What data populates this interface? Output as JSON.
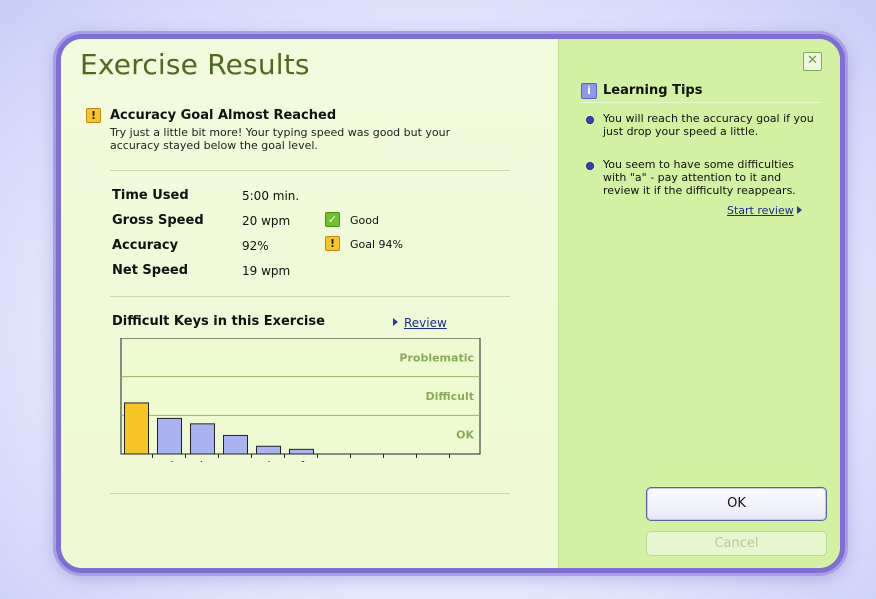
{
  "title": "Exercise Results",
  "goal": {
    "heading": "Accuracy Goal Almost Reached",
    "text": "Try just a little bit more! Your typing speed was good but your accuracy stayed below the goal level."
  },
  "stats": [
    {
      "label": "Time Used",
      "value": "5:00 min.",
      "note": "",
      "note_icon": ""
    },
    {
      "label": "Gross Speed",
      "value": "20 wpm",
      "note": "Good",
      "note_icon": "checkmark-icon"
    },
    {
      "label": "Accuracy",
      "value": "92%",
      "note": "Goal 94%",
      "note_icon": "warning-icon"
    },
    {
      "label": "Net Speed",
      "value": "19 wpm",
      "note": "",
      "note_icon": ""
    }
  ],
  "difficult_keys": {
    "title": "Difficult Keys in this Exercise",
    "review_link": "Review"
  },
  "chart_data": {
    "type": "bar",
    "bands": [
      "Problematic",
      "Difficult",
      "OK"
    ],
    "categories": [
      "a",
      "d",
      "k",
      "s",
      "l",
      "f",
      "",
      "",
      "",
      "",
      ""
    ],
    "values": [
      1.32,
      0.92,
      0.78,
      0.48,
      0.2,
      0.12,
      0,
      0,
      0,
      0,
      0
    ],
    "ylim": [
      0,
      3
    ],
    "highlight_index": 0,
    "colors": {
      "highlight": "#f7c523",
      "normal": "#aab3f2",
      "band_fill": "#eefbd0",
      "band_text": "#8aaa5a"
    }
  },
  "tips": {
    "title": "Learning Tips",
    "items": [
      "You will reach the accuracy goal if you just drop your speed a little.",
      "You seem to have some difficulties with \"a\" - pay attention to it and review it if the difficulty reappears."
    ],
    "start_review": "Start review"
  },
  "buttons": {
    "ok": "OK",
    "cancel": "Cancel"
  },
  "icons": {
    "warning": "warning-icon",
    "info": "info-icon",
    "close": "close-icon",
    "check": "checkmark-icon"
  }
}
